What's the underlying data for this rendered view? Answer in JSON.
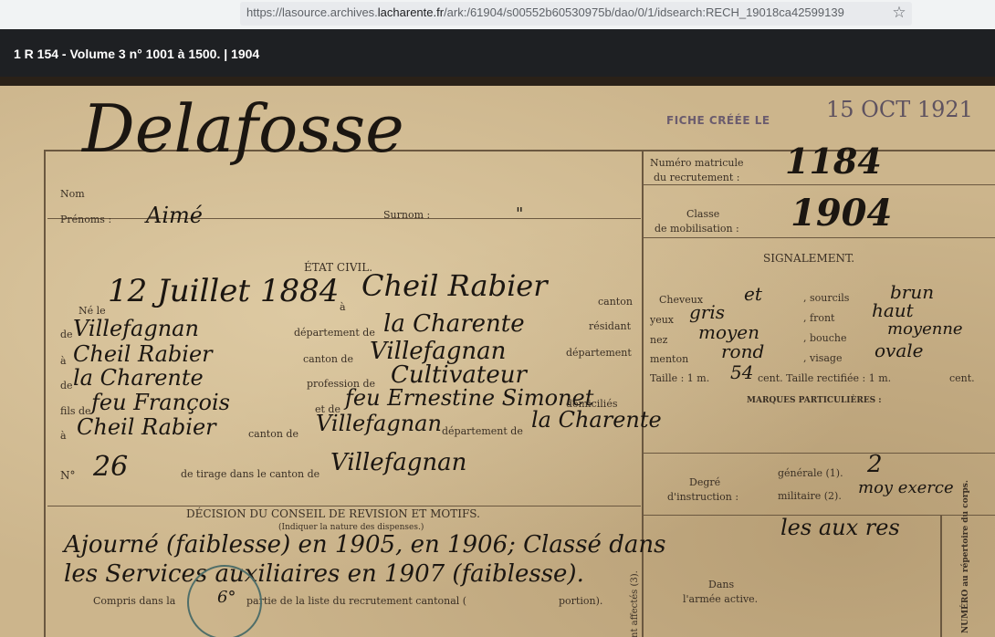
{
  "browser": {
    "url_prefix": "https://lasource.archives.",
    "url_domain": "lacharente.fr",
    "url_suffix": "/ark:/61904/s00552b60530975b/dao/0/1/idsearch:RECH_19018ca42599139",
    "bookmark_icon": "star-icon"
  },
  "viewer": {
    "title": "1 R 154 - Volume 3 n° 1001 à 1500. | 1904"
  },
  "document": {
    "stamp": {
      "label": "FICHE CRÉÉE LE",
      "date": "15 OCT 1921"
    },
    "surname": "Delafosse",
    "labels": {
      "nom": "Nom",
      "prenoms": "Prénoms :",
      "surnom": "Surnom :",
      "etat_civil": "ÉTAT CIVIL.",
      "ne_le": "Né le",
      "a": "à",
      "canton": "canton",
      "de": "de",
      "departement_de": "département de",
      "residant": "résidant",
      "a2": "à",
      "canton_de": "canton de",
      "departement": "département",
      "de2": "de",
      "profession_de": "profession de",
      "fils_de": "fils de",
      "et_de": "et de",
      "domicilies": "domiciliés",
      "a3": "à",
      "canton_de2": "canton de",
      "departement_de2": "département de",
      "no": "N°",
      "de_tirage": "de tirage dans le canton de",
      "decision_title": "DÉCISION DU CONSEIL DE REVISION ET MOTIFS.",
      "decision_sub": "(Indiquer la nature des dispenses.)",
      "compris_dans": "Compris dans la",
      "partie_liste": "partie de la liste du recrutement cantonal (",
      "portion": "portion).",
      "numero_matricule": "Numéro matricule",
      "du_recrutement": "du recrutement :",
      "classe": "Classe",
      "de_mobilisation": "de mobilisation :",
      "signalement": "SIGNALEMENT.",
      "cheveux": "Cheveux",
      "sourcils": ", sourcils",
      "yeux": "yeux",
      "front": ", front",
      "nez": "nez",
      "bouche": ", bouche",
      "menton": "menton",
      "visage": ", visage",
      "taille": "Taille : 1 m.",
      "cent_taille_rectifiee": "cent. Taille rectifiée : 1 m.",
      "cent": "cent.",
      "marques": "MARQUES PARTICULIÈRES :",
      "degre": "Degré",
      "instruction": "d'instruction :",
      "generale": "générale (1).",
      "militaire": "militaire (2).",
      "dans": "Dans",
      "armee_active": "l'armée active.",
      "affectes": "nt affectés (3).",
      "numero_repertoire": "NUMÉRO au répertoire du corps."
    },
    "values": {
      "prenom": "Aimé",
      "surnom": "\"",
      "date_naissance": "12 Juillet 1884",
      "lieu_naissance": "Cheil Rabier",
      "canton_naissance": "Villefagnan",
      "departement_naissance": "la Charente",
      "residence": "Cheil Rabier",
      "canton_residence": "Villefagnan",
      "departement_residence": "la Charente",
      "profession": "Cultivateur",
      "pere": "feu François",
      "mere": "feu Ernestine Simonet",
      "domicile_parents": "Cheil Rabier",
      "canton_parents": "Villefagnan",
      "departement_parents": "la Charente",
      "numero_tirage": "26",
      "canton_tirage": "Villefagnan",
      "decision_line1": "Ajourné (faiblesse) en 1905, en 1906; Classé dans",
      "decision_line2": "les Services auxiliaires en 1907 (faiblesse).",
      "partie": "6°",
      "numero_matricule": "1184",
      "classe": "1904",
      "cheveux": "et",
      "sourcils": "brun",
      "yeux": "gris",
      "front": "haut",
      "nez": "moyen",
      "bouche": "moyenne",
      "menton": "rond",
      "visage": "ovale",
      "taille_cm": "54",
      "instruction_generale": "2",
      "instruction_militaire": "moy exerce",
      "affectation": "les aux res"
    }
  }
}
